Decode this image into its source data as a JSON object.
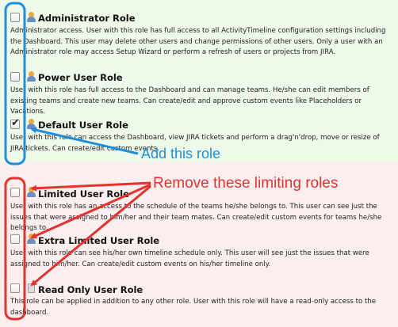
{
  "roles": [
    {
      "title": "Administrator Role",
      "checked": false,
      "icon": "user-icon",
      "description": "Administrator access. User with this role has full access to all ActivityTimeline configuration settings including the Dashboard. This user may delete other users and change permissions of other users. Only a user with an Administrator role may access Setup Wizard or perform a refresh of users or projects from JIRA."
    },
    {
      "title": "Power User Role",
      "checked": false,
      "icon": "user-icon",
      "description": "User with this role has full access to the Dashboard and can manage teams. He/she can edit members of existing teams and create new teams. Can create/edit and approve custom events like Placeholders or Vacations."
    },
    {
      "title": "Default User Role",
      "checked": true,
      "icon": "user-icon",
      "description": "User with this role can access the Dashboard, view JIRA tickets and perform a drag'n'drop, move or resize of JIRA tickets. Can create/edit custom events."
    },
    {
      "title": "Limited User Role",
      "checked": false,
      "icon": "user-icon",
      "description": "User with this role has an access to the schedule of the teams he/she belongs to. This user can see just the issues that were assigned to him/her and their team mates. Can create/edit custom events for teams he/she belongs to."
    },
    {
      "title": "Extra Limited User Role",
      "checked": false,
      "icon": "user-icon",
      "description": "User with this role can see his/her own timeline schedule only. This user will see just the issues that were assigned to him/her. Can create/edit custom events on his/her timeline only."
    },
    {
      "title": "Read Only User Role",
      "checked": false,
      "icon": "document-icon",
      "description": "This role can be applied in addition to any other role. User with this role will have a read-only access to the dashboard."
    }
  ],
  "annotations": {
    "add_label": "Add this role",
    "remove_label": "Remove these limiting roles",
    "add_color": "#1c8ee0",
    "remove_color": "#e5322f"
  }
}
